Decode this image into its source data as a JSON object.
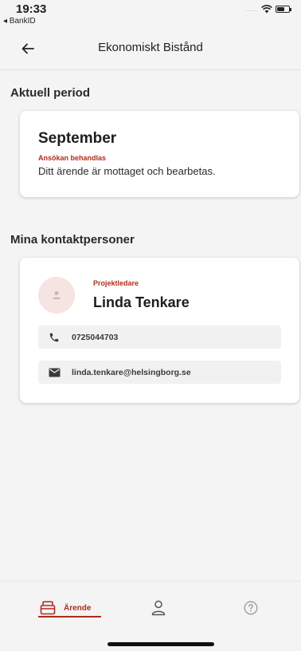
{
  "status_bar": {
    "time": "19:33",
    "back_app": "◂ BankID",
    "signal": "....."
  },
  "header": {
    "title": "Ekonomiskt Bistånd"
  },
  "current_period": {
    "section_title": "Aktuell period",
    "month": "September",
    "status": "Ansökan behandlas",
    "description": "Ditt ärende är mottaget och bearbetas."
  },
  "contacts": {
    "section_title": "Mina kontaktpersoner",
    "person": {
      "role": "Projektledare",
      "name": "Linda Tenkare",
      "phone": "0725044703",
      "email": "linda.tenkare@helsingborg.se"
    }
  },
  "bottom_nav": {
    "arende_label": "Ärende"
  },
  "colors": {
    "accent": "#b22b1e",
    "avatar_bg": "#f6e4e2",
    "background": "#f4f4f4"
  }
}
